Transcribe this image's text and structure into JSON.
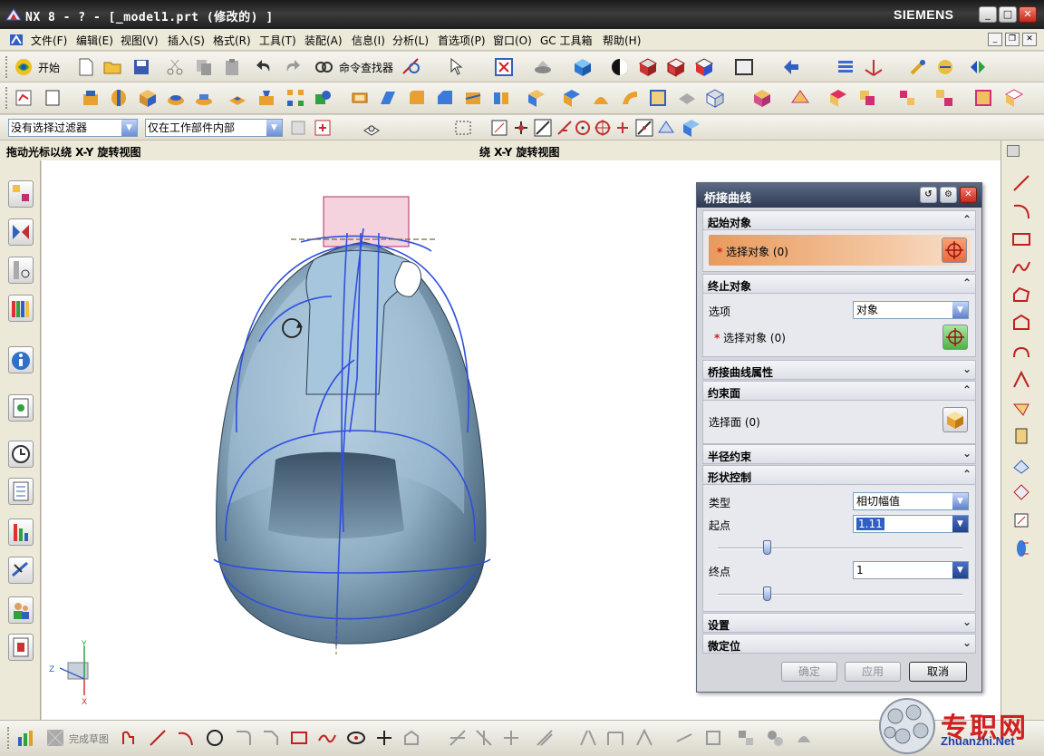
{
  "window": {
    "title": "NX 8 - ? - [_model1.prt  (修改的) ]",
    "brand": "SIEMENS",
    "controls": {
      "minimize": "_",
      "maximize": "□",
      "close": "✕"
    }
  },
  "menu": {
    "items": [
      "文件(F)",
      "编辑(E)",
      "视图(V)",
      "插入(S)",
      "格式(R)",
      "工具(T)",
      "装配(A)",
      "信息(I)",
      "分析(L)",
      "首选项(P)",
      "窗口(O)",
      "GC 工具箱",
      "帮助(H)"
    ]
  },
  "toolbar": {
    "start_label": "开始",
    "command_finder_label": "命令查找器",
    "filter_value": "没有选择过滤器",
    "scope_value": "仅在工作部件内部"
  },
  "viewport": {
    "hint_left": "拖动光标以绕 X-Y 旋转视图",
    "hint_right": "绕 X-Y 旋转视图",
    "axis_y": "Y",
    "axis_z": "Z",
    "axis_x": "X"
  },
  "dialog": {
    "title": "桥接曲线",
    "sections": {
      "start_object": "起始对象",
      "end_object": "终止对象",
      "bridge_props": "桥接曲线属性",
      "constraint_face": "约束面",
      "radius_constraint": "半径约束",
      "shape_control": "形状控制",
      "settings": "设置",
      "fine_position": "微定位"
    },
    "start_select_label": "选择对象 (0)",
    "option_label": "选项",
    "option_value": "对象",
    "end_select_label": "选择对象 (0)",
    "face_select_label": "选择面 (0)",
    "type_label": "类型",
    "type_value": "相切幅值",
    "start_point_label": "起点",
    "start_point_value": "1.11",
    "end_point_label": "终点",
    "end_point_value": "1",
    "start_slider_fraction": 0.2,
    "end_slider_fraction": 0.2,
    "buttons": {
      "ok": "确定",
      "apply": "应用",
      "cancel": "取消"
    }
  },
  "bottom": {
    "finish_sketch_label": "完成草图"
  },
  "watermark": {
    "zh": "专职网",
    "en": "Zhuanzhi.Net"
  },
  "colors": {
    "dialog_title": "#2e3a52",
    "selection_highlight": "#f0a060",
    "model_surface": "#6f93ad",
    "curve_blue": "#2f4fe0"
  }
}
